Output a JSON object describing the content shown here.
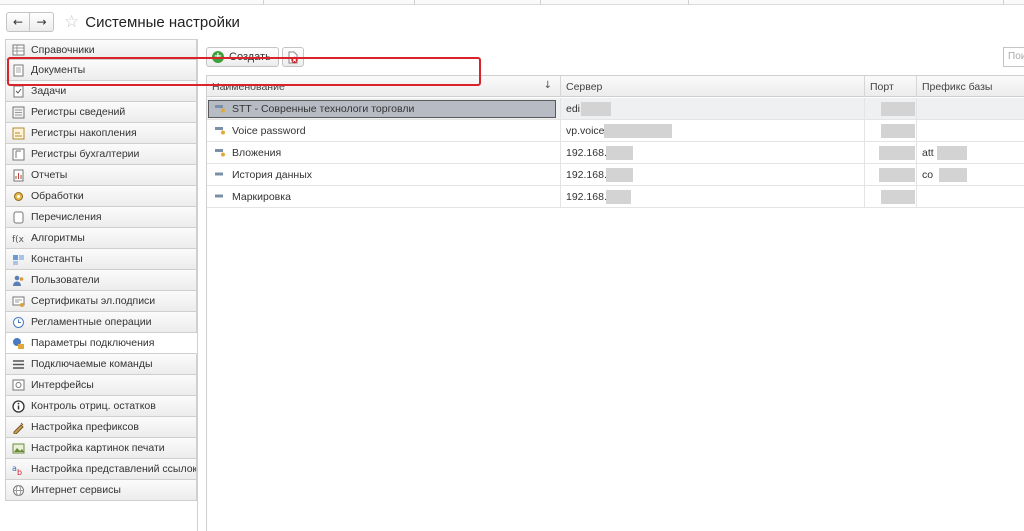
{
  "window": {
    "title": "Системные настройки"
  },
  "sidebar": {
    "items": [
      {
        "label": "Справочники",
        "icon": "catalog-icon"
      },
      {
        "label": "Документы",
        "icon": "document-icon"
      },
      {
        "label": "Задачи",
        "icon": "task-icon"
      },
      {
        "label": "Регистры сведений",
        "icon": "info-register-icon"
      },
      {
        "label": "Регистры накопления",
        "icon": "accumulation-register-icon"
      },
      {
        "label": "Регистры бухгалтерии",
        "icon": "accounting-register-icon"
      },
      {
        "label": "Отчеты",
        "icon": "report-icon"
      },
      {
        "label": "Обработки",
        "icon": "processing-icon"
      },
      {
        "label": "Перечисления",
        "icon": "enum-icon"
      },
      {
        "label": "Алгоритмы",
        "icon": "algorithm-icon"
      },
      {
        "label": "Константы",
        "icon": "constant-icon"
      },
      {
        "label": "Пользователи",
        "icon": "users-icon"
      },
      {
        "label": "Сертификаты эл.подписи",
        "icon": "certificate-icon"
      },
      {
        "label": "Регламентные операции",
        "icon": "clock-icon"
      },
      {
        "label": "Параметры подключения",
        "icon": "connection-icon"
      },
      {
        "label": "Подключаемые команды",
        "icon": "list-icon"
      },
      {
        "label": "Интерфейсы",
        "icon": "interface-icon"
      },
      {
        "label": "Контроль отриц. остатков",
        "icon": "info-icon"
      },
      {
        "label": "Настройка префиксов",
        "icon": "prefix-icon"
      },
      {
        "label": "Настройка картинок печати",
        "icon": "picture-icon"
      },
      {
        "label": "Настройка представлений ссылок",
        "icon": "link-view-icon"
      },
      {
        "label": "Интернет сервисы",
        "icon": "web-service-icon"
      }
    ],
    "active_index": 14
  },
  "toolbar": {
    "create_label": "Создать",
    "search_placeholder": "Поис"
  },
  "table": {
    "columns": {
      "name": "Наименование",
      "server": "Сервер",
      "port": "Порт",
      "prefix": "Префикс базы"
    },
    "sort_indicator": "↓",
    "rows": [
      {
        "name": "STT - Совренные технологи торговли",
        "server": "edi.",
        "prefix": "",
        "selected": true
      },
      {
        "name": "Voice password",
        "server": "vp.voicep",
        "prefix": ""
      },
      {
        "name": "Вложения",
        "server": "192.168.",
        "prefix": "att"
      },
      {
        "name": "История данных",
        "server": "192.168.",
        "prefix": "co"
      },
      {
        "name": "Маркировка",
        "server": "192.168.",
        "prefix": ""
      }
    ]
  },
  "colors": {
    "highlight_frame": "#d9222a",
    "selection": "#b7bcc4"
  }
}
